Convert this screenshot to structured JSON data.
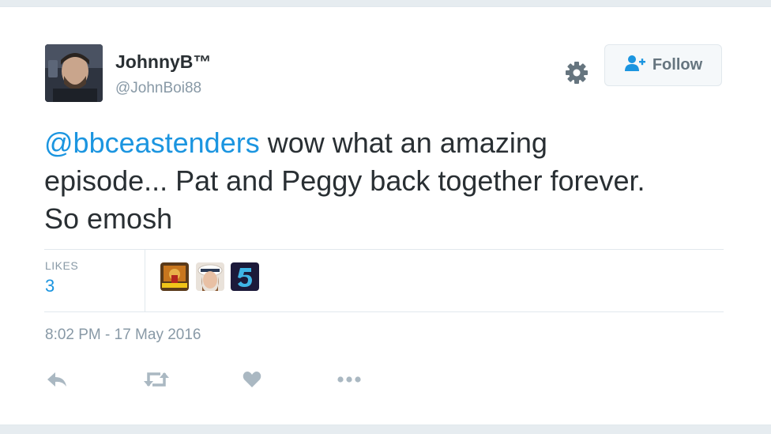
{
  "user": {
    "display_name": "JohnnyB™",
    "handle": "@JohnBoi88",
    "avatar_icon": "profile-photo"
  },
  "follow_button": {
    "label": "Follow",
    "icon": "follow-user-icon"
  },
  "settings_icon": "gear-icon",
  "tweet": {
    "mention": "@bbceastenders",
    "text": " wow what an amazing episode... Pat and Peggy back together forever. So emosh"
  },
  "stats": {
    "likes_label": "LIKES",
    "likes_count": "3"
  },
  "likers": [
    {
      "name": "liker-avatar-1",
      "icon": "photo-avatar"
    },
    {
      "name": "liker-avatar-2",
      "icon": "photo-avatar"
    },
    {
      "name": "liker-avatar-3",
      "icon": "channel-5-logo"
    }
  ],
  "timestamp": "8:02 PM - 17 May 2016",
  "actions": [
    "reply-icon",
    "retweet-icon",
    "like-icon",
    "more-icon"
  ],
  "colors": {
    "link": "#1b95e0",
    "text": "#292f33",
    "muted": "#8899a6",
    "action_icon": "#aab8c2",
    "follow_icon": "#1b95e0"
  }
}
